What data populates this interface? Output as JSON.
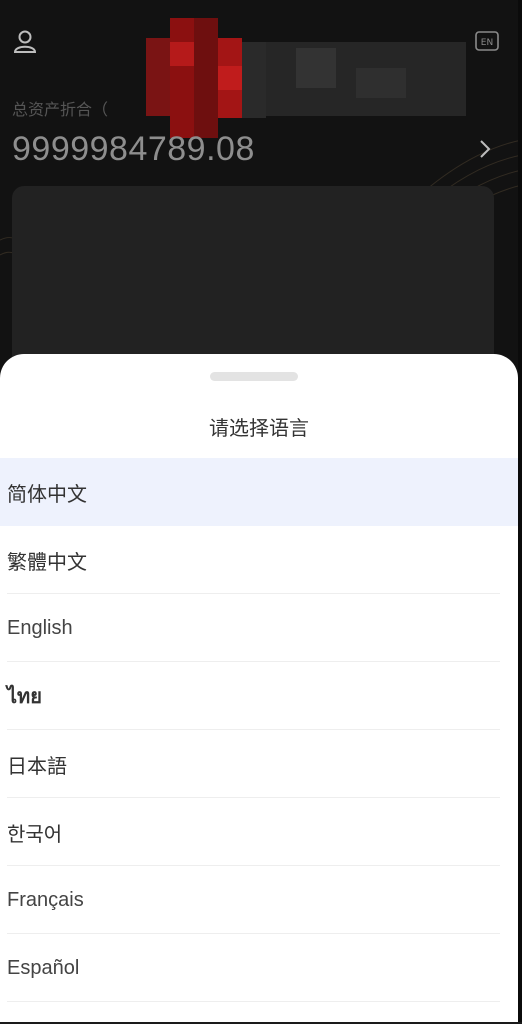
{
  "background_app": {
    "asset_label": "总资产折合（",
    "asset_value": "9999984789.08",
    "icons": {
      "user": "user-icon",
      "language": "language-en-icon",
      "chevron": "chevron-right-icon"
    }
  },
  "language_sheet": {
    "title": "请选择语言",
    "options": [
      {
        "label": "简体中文",
        "selected": true
      },
      {
        "label": "繁體中文",
        "selected": false
      },
      {
        "label": "English",
        "selected": false
      },
      {
        "label": "ไทย",
        "selected": false
      },
      {
        "label": "日本語",
        "selected": false
      },
      {
        "label": "한국어",
        "selected": false
      },
      {
        "label": "Français",
        "selected": false
      },
      {
        "label": "Español",
        "selected": false
      }
    ]
  },
  "colors": {
    "background": "#121212",
    "sheet": "#ffffff",
    "selected_row": "#eef2fd",
    "text": "#333333"
  }
}
